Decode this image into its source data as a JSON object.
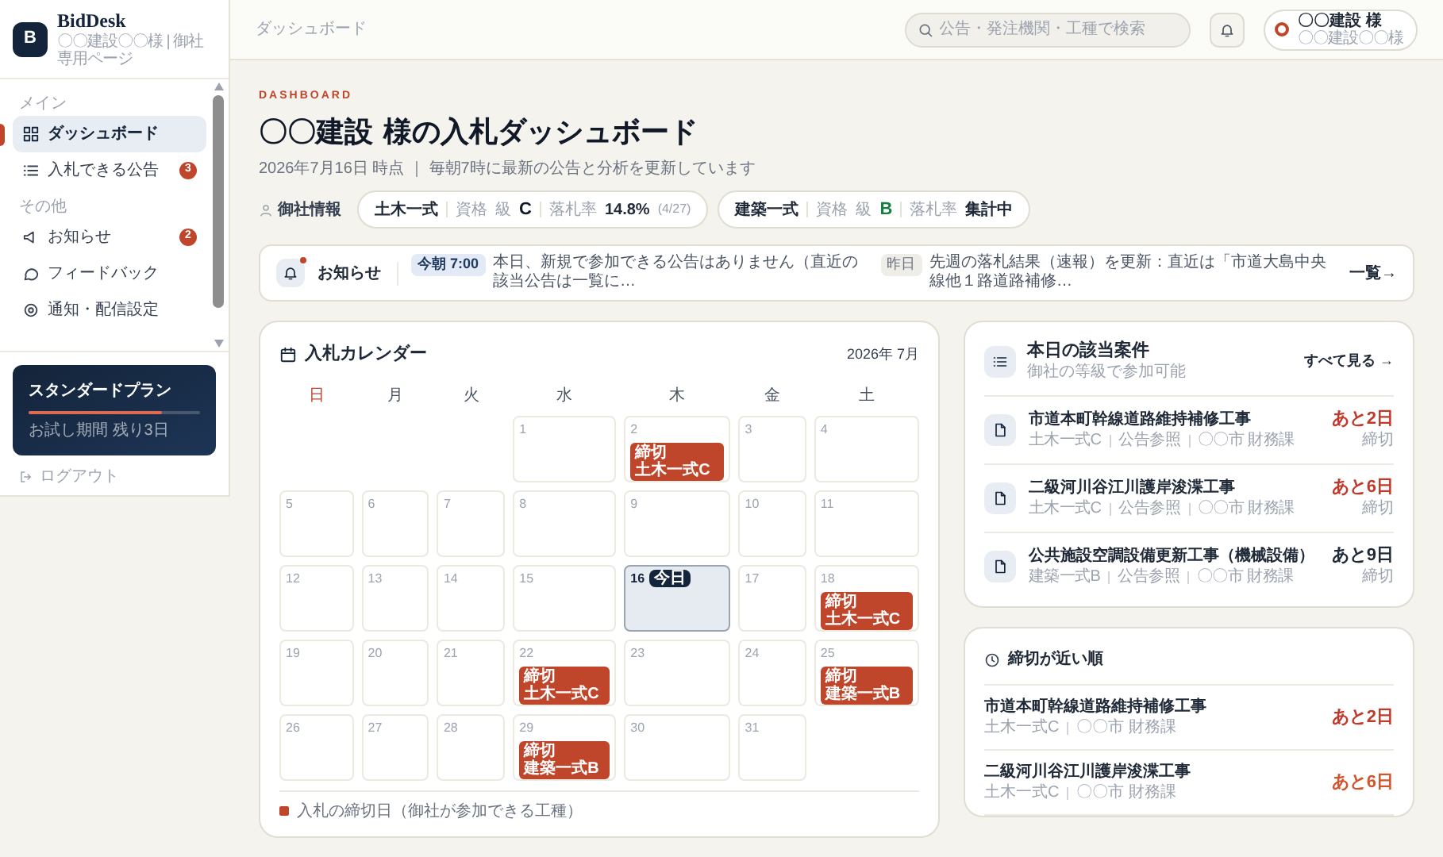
{
  "sidebar": {
    "brand": {
      "logo": "B",
      "name": "BidDesk",
      "subtitle": "〇〇建設〇〇様 | 御社専用ページ"
    },
    "sections": [
      {
        "heading": "メイン",
        "items": [
          {
            "label": "ダッシュボード",
            "selected": true
          },
          {
            "label": "入札できる公告",
            "selected": false,
            "badge": "3"
          }
        ]
      },
      {
        "heading": "その他",
        "items": [
          {
            "label": "お知らせ",
            "selected": false,
            "badge": "2"
          },
          {
            "label": "フィードバック",
            "selected": false
          },
          {
            "label": "通知・配信設定",
            "selected": false
          }
        ]
      }
    ],
    "plan": {
      "name": "スタンダードプラン",
      "level": 0.78,
      "note": "お試し期間 残り3日"
    },
    "logout": "ログアウト"
  },
  "header": {
    "breadcrumb": "ダッシュボード",
    "search": {
      "placeholder": "公告・発注機関・工種で検索"
    },
    "user": {
      "name": "〇〇建設 様",
      "subtitle": "〇〇建設〇〇様"
    }
  },
  "page": {
    "eyebrow": "DASHBOARD",
    "title": "〇〇建設 様の入札ダッシュボード",
    "subtitle": "2026年7月16日 時点 ｜ 毎朝7時に最新の公告と分析を更新しています",
    "company": {
      "label": "御社情報",
      "trades": [
        {
          "name": "土木一式",
          "grade_label": "資格",
          "grade_prefix": "級",
          "grade": "C",
          "rate_label": "落札率",
          "rate": "14.8%",
          "rate_detail": "(4/27)"
        },
        {
          "name": "建築一式",
          "grade_label": "資格",
          "grade_prefix": "級",
          "grade": "B",
          "rate_label": "落札率",
          "rate": "集計中"
        }
      ]
    }
  },
  "notices": {
    "label": "お知らせ",
    "unread": true,
    "messages": [
      {
        "tag": "今朝 7:00",
        "text": "本日、新規で参加できる公告はありません（直近の該当公告は一覧に…"
      },
      {
        "tag": "昨日",
        "text": "先週の落札結果（速報）を更新：直近は「市道大島中央線他１路道路補修…"
      }
    ],
    "link": "一覧→"
  },
  "calendar": {
    "title": "入札カレンダー",
    "month": "2026年 7月",
    "weekdays": [
      "日",
      "月",
      "火",
      "水",
      "木",
      "金",
      "土"
    ],
    "weeks": [
      [
        {
          "kind": "blank"
        },
        {
          "kind": "blank"
        },
        {
          "kind": "blank"
        },
        {
          "day": "1",
          "today": false
        },
        {
          "day": "2",
          "today": false,
          "events": [
            {
              "label": "締切",
              "trade": "土木一式C"
            }
          ]
        },
        {
          "day": "3",
          "today": false
        },
        {
          "day": "4",
          "today": false
        }
      ],
      [
        {
          "day": "5",
          "today": false
        },
        {
          "day": "6",
          "today": false
        },
        {
          "day": "7",
          "today": false
        },
        {
          "day": "8",
          "today": false
        },
        {
          "day": "9",
          "today": false
        },
        {
          "day": "10",
          "today": false
        },
        {
          "day": "11",
          "today": false
        }
      ],
      [
        {
          "day": "12",
          "today": false
        },
        {
          "day": "13",
          "today": false
        },
        {
          "day": "14",
          "today": false
        },
        {
          "day": "15",
          "today": false
        },
        {
          "day": "16",
          "today": true,
          "badge": "今日"
        },
        {
          "day": "17",
          "today": false
        },
        {
          "day": "18",
          "today": false,
          "events": [
            {
              "label": "締切",
              "trade": "土木一式C"
            }
          ]
        }
      ],
      [
        {
          "day": "19",
          "today": false
        },
        {
          "day": "20",
          "today": false
        },
        {
          "day": "21",
          "today": false
        },
        {
          "day": "22",
          "today": false,
          "events": [
            {
              "label": "締切",
              "trade": "土木一式C"
            }
          ]
        },
        {
          "day": "23",
          "today": false
        },
        {
          "day": "24",
          "today": false
        },
        {
          "day": "25",
          "today": false,
          "events": [
            {
              "label": "締切",
              "trade": "建築一式B"
            }
          ]
        }
      ],
      [
        {
          "day": "26",
          "today": false
        },
        {
          "day": "27",
          "today": false
        },
        {
          "day": "28",
          "today": false
        },
        {
          "day": "29",
          "today": false,
          "events": [
            {
              "label": "締切",
              "trade": "建築一式B"
            }
          ]
        },
        {
          "day": "30",
          "today": false
        },
        {
          "day": "31",
          "today": false
        },
        {
          "kind": "blank"
        }
      ]
    ],
    "legend": "入札の締切日（御社が参加できる工種）"
  },
  "todays_matches": {
    "title": "本日の該当案件",
    "subtitle": "御社の等級で参加可能",
    "link": "すべて見る →",
    "items": [
      {
        "title": "市道本町幹線道路維持補修工事",
        "meta": [
          "土木一式C",
          "公告参照",
          "〇〇市 財務課"
        ],
        "remaining": "あと2日",
        "color": "#c0392b",
        "deadline": "締切"
      },
      {
        "title": "二級河川谷江川護岸浚渫工事",
        "meta": [
          "土木一式C",
          "公告参照",
          "〇〇市 財務課"
        ],
        "remaining": "あと6日",
        "color": "#c0392b",
        "deadline": "締切"
      },
      {
        "title": "公共施設空調設備更新工事（機械設備）",
        "meta": [
          "建築一式B",
          "公告参照",
          "〇〇市 財務課"
        ],
        "remaining": "あと9日",
        "color": "#1f2937",
        "deadline": "締切"
      }
    ]
  },
  "upcoming": {
    "title": "締切が近い順",
    "items": [
      {
        "title": "市道本町幹線道路維持補修工事",
        "meta": [
          "土木一式C",
          "〇〇市 財務課"
        ],
        "remaining": "あと2日",
        "color": "#c0392b"
      },
      {
        "title": "二級河川谷江川護岸浚渫工事",
        "meta": [
          "土木一式C",
          "〇〇市 財務課"
        ],
        "remaining": "あと6日",
        "color": "#d0542c"
      }
    ]
  }
}
